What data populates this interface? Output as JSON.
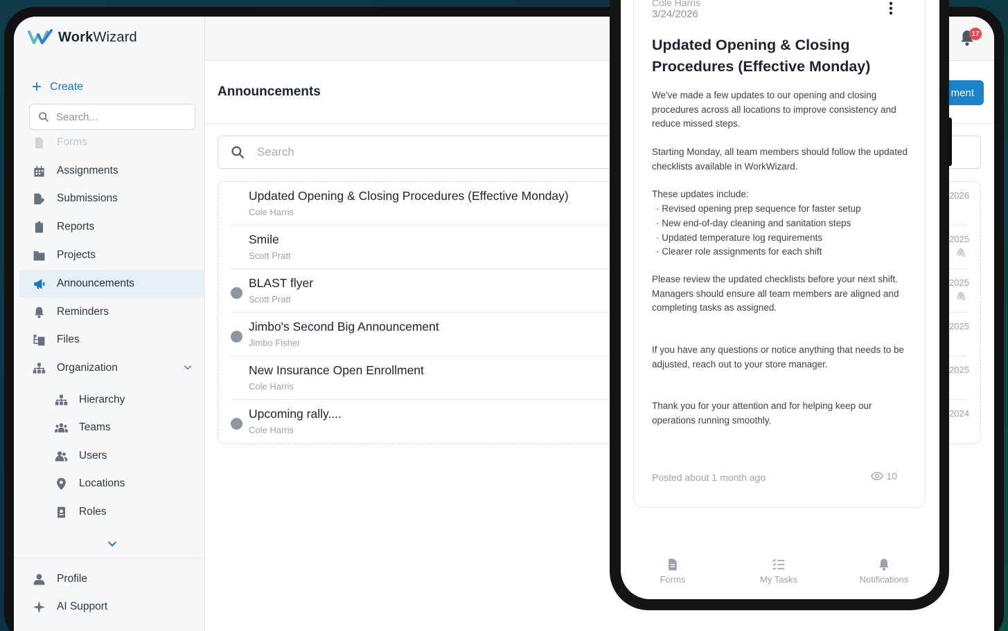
{
  "app": {
    "brand_bold": "Work",
    "brand_rest": "Wizard"
  },
  "sidebar": {
    "create_label": "Create",
    "search_placeholder": "Search...",
    "items": [
      {
        "label": "Forms",
        "icon": "file-icon"
      },
      {
        "label": "Assignments",
        "icon": "calendar-icon"
      },
      {
        "label": "Submissions",
        "icon": "file-edit-icon"
      },
      {
        "label": "Reports",
        "icon": "clipboard-icon"
      },
      {
        "label": "Projects",
        "icon": "folder-icon"
      },
      {
        "label": "Announcements",
        "icon": "megaphone-icon"
      },
      {
        "label": "Reminders",
        "icon": "bell-icon"
      },
      {
        "label": "Files",
        "icon": "folder-tree-icon"
      },
      {
        "label": "Organization",
        "icon": "sitemap-icon"
      },
      {
        "label": "Hierarchy",
        "icon": "sitemap-icon"
      },
      {
        "label": "Teams",
        "icon": "team-icon"
      },
      {
        "label": "Users",
        "icon": "users-icon"
      },
      {
        "label": "Locations",
        "icon": "location-pin-icon"
      },
      {
        "label": "Roles",
        "icon": "id-badge-icon"
      }
    ],
    "profile_label": "Profile",
    "ai_support_label": "AI Support"
  },
  "header": {
    "notification_count": "17"
  },
  "main": {
    "title": "Announcements",
    "new_button_label": "ment",
    "search_placeholder": "Search",
    "announcements": [
      {
        "title": "Updated Opening & Closing Procedures (Effective Monday)",
        "author": "Cole Harris",
        "date": "2026",
        "unread": false,
        "attachment": false
      },
      {
        "title": "Smile",
        "author": "Scott Pratt",
        "date": "2025",
        "unread": false,
        "attachment": true
      },
      {
        "title": "BLAST flyer",
        "author": "Scott Pratt",
        "date": "2025",
        "unread": true,
        "attachment": true
      },
      {
        "title": "Jimbo's Second Big Announcement",
        "author": "Jimbo Fisher",
        "date": "2025",
        "unread": true,
        "attachment": false
      },
      {
        "title": "New Insurance Open Enrollment",
        "author": "Cole Harris",
        "date": "2025",
        "unread": false,
        "attachment": false
      },
      {
        "title": "Upcoming rally....",
        "author": "Cole Harris",
        "date": "2024",
        "unread": true,
        "attachment": false
      }
    ]
  },
  "phone": {
    "author": "Cole Harris",
    "date": "3/24/2026",
    "headline": "Updated Opening & Closing Procedures (Effective Monday)",
    "para1": "We've made a few updates to our opening and closing procedures across all locations to improve consistency and reduce missed steps.",
    "para2": "Starting Monday, all team members should follow the updated checklists available in WorkWizard.",
    "para3": "These updates include:",
    "bullets": [
      "· Revised opening prep sequence for faster setup",
      "· New end-of-day cleaning and sanitation steps",
      "· Updated temperature log requirements",
      "· Clearer role assignments for each shift"
    ],
    "para4": "Please review the updated checklists before your next shift. Managers should ensure all team members are aligned and completing tasks as assigned.",
    "para5": "If you have any questions or notice anything that needs to be adjusted, reach out to your store manager.",
    "para6": "Thank you for your attention and for helping keep our operations running smoothly.",
    "posted": "Posted about 1 month ago",
    "views": "10",
    "tabs": [
      {
        "label": "Forms",
        "icon": "file-icon"
      },
      {
        "label": "My Tasks",
        "icon": "checklist-icon"
      },
      {
        "label": "Notifications",
        "icon": "bell-icon"
      }
    ]
  },
  "colors": {
    "accent": "#1276c4",
    "button": "#1b82c9",
    "badge": "#e5484d"
  }
}
